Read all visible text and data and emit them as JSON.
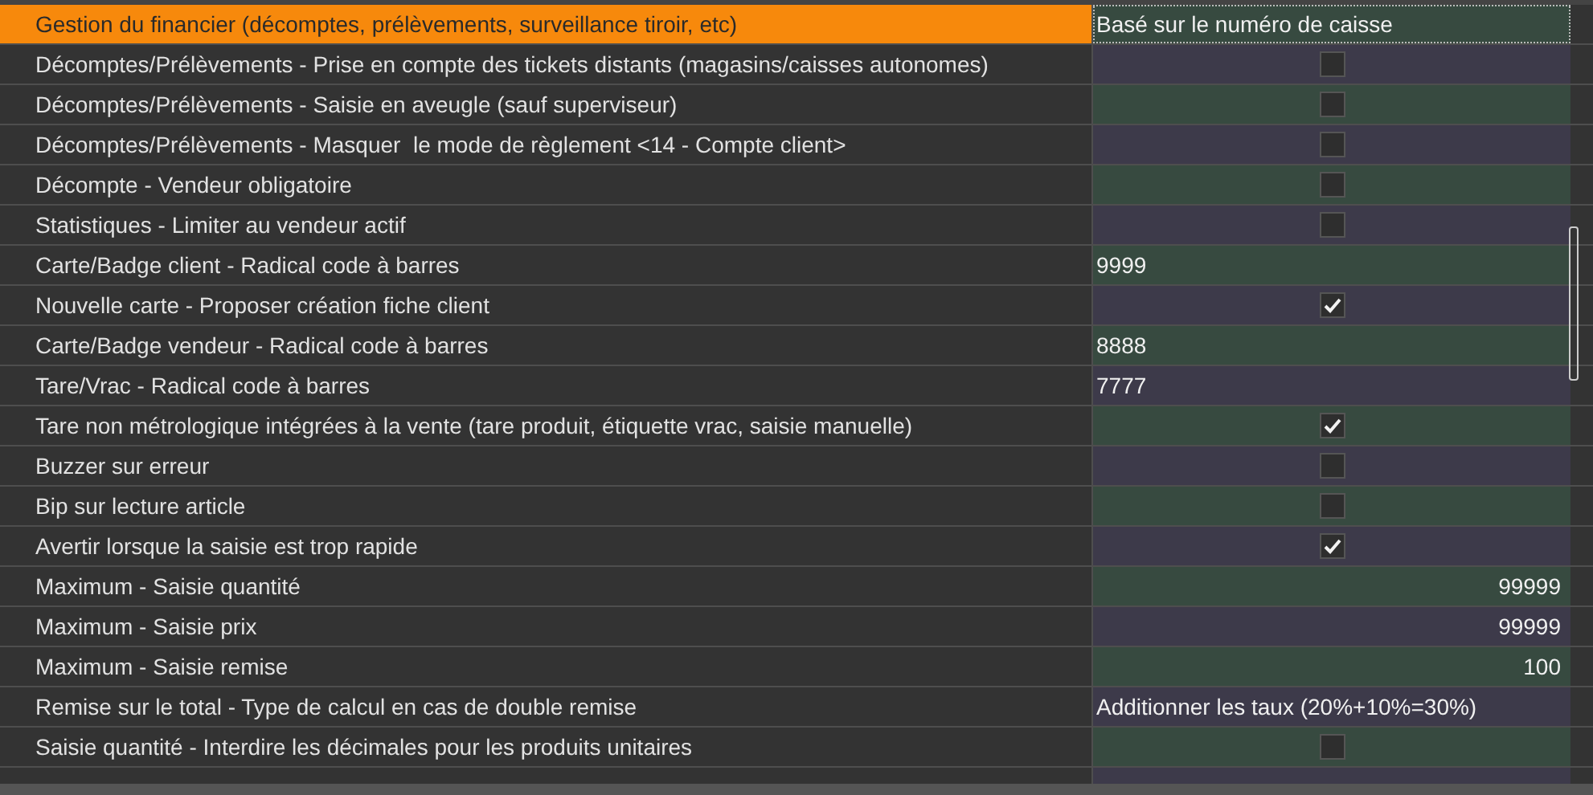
{
  "settings": [
    {
      "label": "Gestion du financier (décomptes, prélèvements, surveillance tiroir, etc)",
      "kind": "text",
      "value": "Basé sur le numéro de caisse",
      "selected": true
    },
    {
      "label": "Décomptes/Prélèvements - Prise en compte des tickets distants (magasins/caisses autonomes)",
      "kind": "checkbox",
      "checked": false,
      "selected": false
    },
    {
      "label": "Décomptes/Prélèvements - Saisie en aveugle (sauf superviseur)",
      "kind": "checkbox",
      "checked": false,
      "selected": false
    },
    {
      "label": "Décomptes/Prélèvements - Masquer  le mode de règlement <14 - Compte client>",
      "kind": "checkbox",
      "checked": false,
      "selected": false
    },
    {
      "label": "Décompte - Vendeur obligatoire",
      "kind": "checkbox",
      "checked": false,
      "selected": false
    },
    {
      "label": "Statistiques - Limiter au vendeur actif",
      "kind": "checkbox",
      "checked": false,
      "selected": false
    },
    {
      "label": "Carte/Badge client - Radical code à barres",
      "kind": "text",
      "value": "9999",
      "selected": false
    },
    {
      "label": "Nouvelle carte - Proposer création fiche client",
      "kind": "checkbox",
      "checked": true,
      "selected": false
    },
    {
      "label": "Carte/Badge vendeur - Radical code à barres",
      "kind": "text",
      "value": "8888",
      "selected": false
    },
    {
      "label": "Tare/Vrac - Radical code à barres",
      "kind": "text",
      "value": "7777",
      "selected": false
    },
    {
      "label": "Tare non métrologique intégrées à la vente (tare produit, étiquette vrac, saisie manuelle)",
      "kind": "checkbox",
      "checked": true,
      "selected": false
    },
    {
      "label": "Buzzer sur erreur",
      "kind": "checkbox",
      "checked": false,
      "selected": false
    },
    {
      "label": "Bip sur lecture article",
      "kind": "checkbox",
      "checked": false,
      "selected": false
    },
    {
      "label": "Avertir lorsque la saisie est trop rapide",
      "kind": "checkbox",
      "checked": true,
      "selected": false
    },
    {
      "label": "Maximum - Saisie quantité",
      "kind": "number",
      "value": "99999",
      "selected": false
    },
    {
      "label": "Maximum - Saisie prix",
      "kind": "number",
      "value": "99999",
      "selected": false
    },
    {
      "label": "Maximum - Saisie remise",
      "kind": "number",
      "value": "100",
      "selected": false
    },
    {
      "label": "Remise sur le total - Type de calcul en cas de double remise",
      "kind": "text",
      "value": "Additionner les taux (20%+10%=30%)",
      "selected": false
    },
    {
      "label": "Saisie quantité - Interdire les décimales pour les produits unitaires",
      "kind": "checkbox",
      "checked": false,
      "selected": false
    }
  ]
}
